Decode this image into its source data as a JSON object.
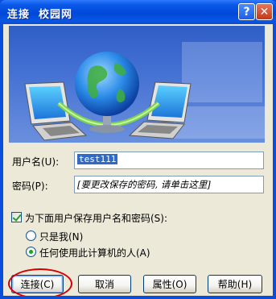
{
  "window": {
    "title": "连接  校园网",
    "help_glyph": "?",
    "close_glyph": "✕"
  },
  "banner": {
    "icon": "network-connection-illustration",
    "colors": {
      "sky": "#3d6ad0",
      "globe": "#2b8be8",
      "arc": "#7ed34e"
    }
  },
  "form": {
    "username_label": "用户名(U):",
    "username_value": "test111",
    "password_label": "密码(P):",
    "password_value": "[要更改保存的密码, 请单击这里]",
    "save_checkbox_label": "为下面用户保存用户名和密码(S):",
    "save_checked": true,
    "radio_me_label": "只是我(N)",
    "radio_anyone_label": "任何使用此计算机的人(A)",
    "selected_radio": "anyone"
  },
  "buttons": {
    "connect": "连接(C)",
    "cancel": "取消",
    "properties": "属性(O)",
    "help": "帮助(H)"
  },
  "annotation": {
    "color": "#d40000"
  }
}
